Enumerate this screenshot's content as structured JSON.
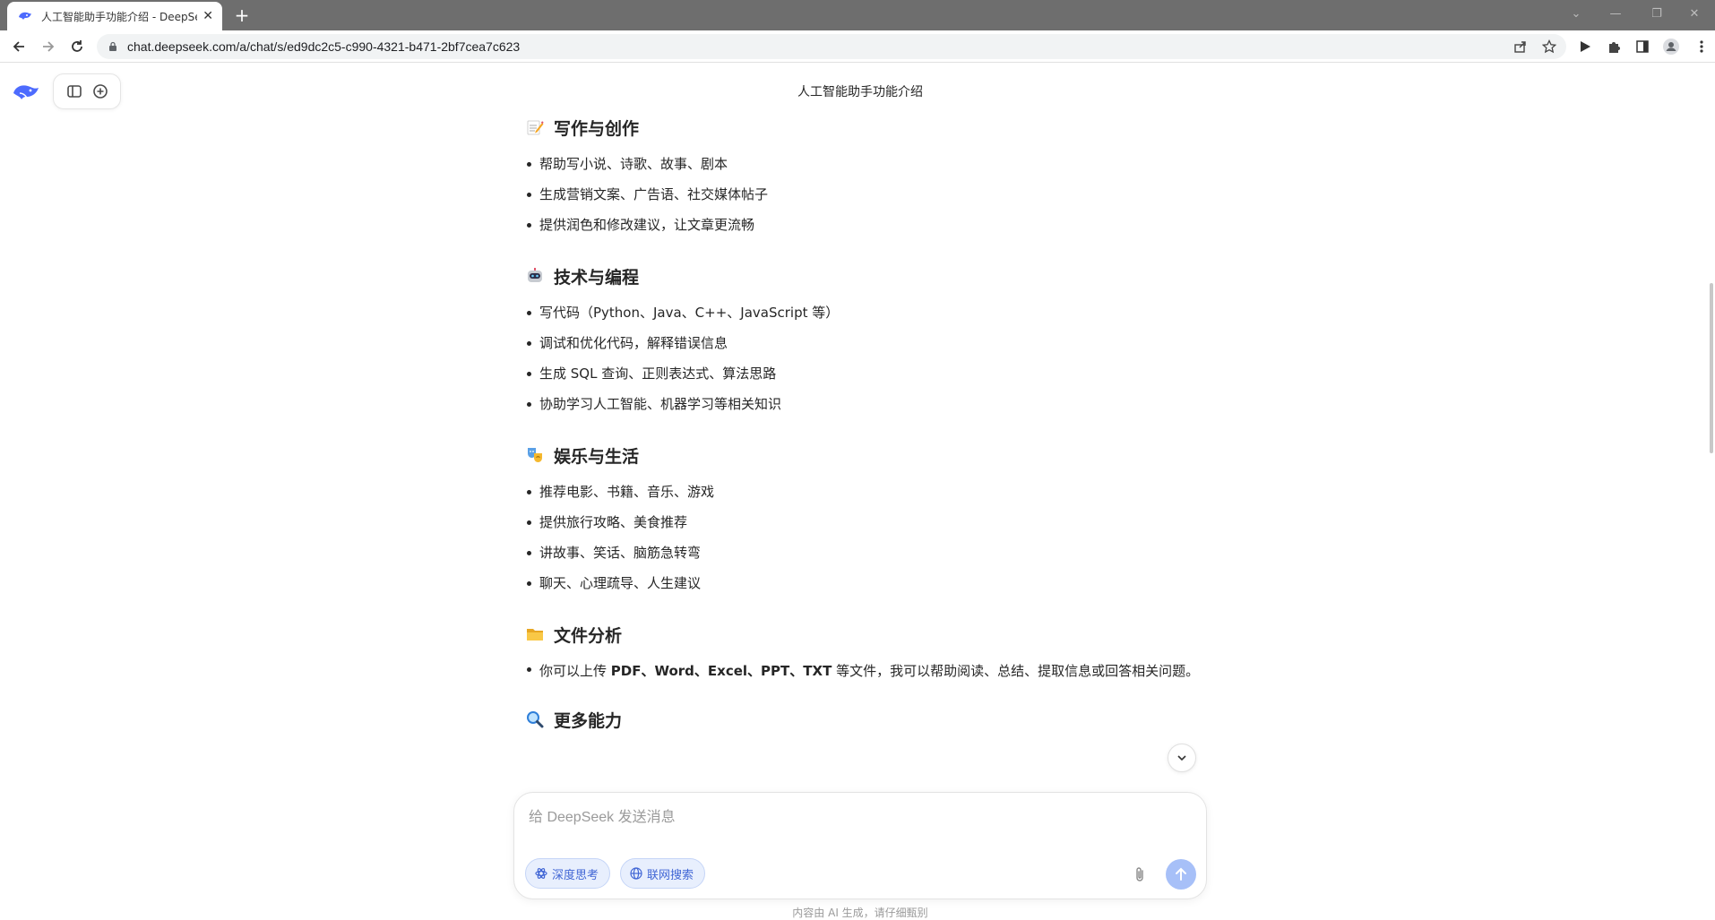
{
  "browser": {
    "tab_title": "人工智能助手功能介绍 - DeepSeek",
    "url": "chat.deepseek.com/a/chat/s/ed9dc2c5-c990-4321-b471-2bf7cea7c623"
  },
  "chat": {
    "title": "人工智能助手功能介绍"
  },
  "sections": [
    {
      "icon": "memo-emoji",
      "title": "写作与创作",
      "items": [
        "帮助写小说、诗歌、故事、剧本",
        "生成营销文案、广告语、社交媒体帖子",
        "提供润色和修改建议，让文章更流畅"
      ]
    },
    {
      "icon": "robot-emoji",
      "title": "技术与编程",
      "items": [
        "写代码（Python、Java、C++、JavaScript 等）",
        "调试和优化代码，解释错误信息",
        "生成 SQL 查询、正则表达式、算法思路",
        "协助学习人工智能、机器学习等相关知识"
      ]
    },
    {
      "icon": "performing-arts-emoji",
      "title": "娱乐与生活",
      "items": [
        "推荐电影、书籍、音乐、游戏",
        "提供旅行攻略、美食推荐",
        "讲故事、笑话、脑筋急转弯",
        "聊天、心理疏导、人生建议"
      ]
    },
    {
      "icon": "folder-emoji",
      "title": "文件分析",
      "file_item": {
        "prefix": "你可以上传 ",
        "formats": "PDF、Word、Excel、PPT、TXT",
        "suffix": " 等文件，我可以帮助阅读、总结、提取信息或回答相关问题。"
      }
    },
    {
      "icon": "magnifier-emoji",
      "title": "更多能力"
    }
  ],
  "composer": {
    "placeholder": "给 DeepSeek 发送消息",
    "deep_think_label": "深度思考",
    "web_search_label": "联网搜索"
  },
  "footer_note": "内容由 AI 生成，请仔细甄别",
  "colors": {
    "accent": "#4D6BFE",
    "chip_bg": "#E8EFFD",
    "send_disabled": "#A7C0F8"
  }
}
